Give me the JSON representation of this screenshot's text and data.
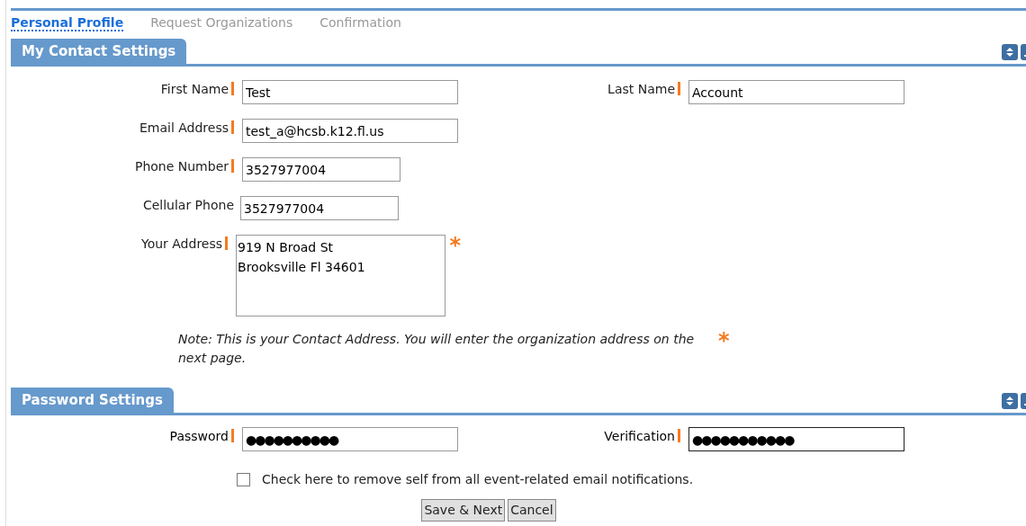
{
  "steps": [
    {
      "label": "Personal Profile",
      "selected": true
    },
    {
      "label": "Request Organizations",
      "selected": false
    },
    {
      "label": "Confirmation",
      "selected": false
    }
  ],
  "contact": {
    "title": "My Contact Settings",
    "rows": [
      {
        "left": {
          "label": "First Name",
          "value": "Test",
          "required": true,
          "kind": "long"
        },
        "right": {
          "label": "Last Name",
          "value": "Account",
          "required": true,
          "kind": "long"
        }
      },
      {
        "left": {
          "label": "Email Address",
          "value": "test_a@hcsb.k12.fl.us",
          "required": true,
          "kind": "long"
        }
      },
      {
        "left": {
          "label": "Phone Number",
          "value": "3527977004",
          "required": true,
          "kind": "short"
        }
      },
      {
        "left": {
          "label": "Cellular Phone",
          "value": "3527977004",
          "required": false,
          "kind": "short"
        }
      },
      {
        "left": {
          "label": "Your Address",
          "value": "919 N Broad St\nBrooksville Fl 34601",
          "required": true,
          "kind": "area",
          "mark": "*"
        }
      }
    ],
    "note": "Note: This is your Contact Address. You will enter the organization address on the next page.",
    "note_mark": "*"
  },
  "password": {
    "title": "Password Settings",
    "fields": [
      {
        "label": "Password",
        "value": "●●●●●●●●●●",
        "required": true,
        "focused": false
      },
      {
        "label": "Verification",
        "value": "●●●●●●●●●●●",
        "required": true,
        "focused": true
      }
    ],
    "opt_out": {
      "label": "Check here to remove self from all event-related email notifications.",
      "checked": false
    }
  },
  "buttons": [
    "Save & Next",
    "Cancel"
  ]
}
